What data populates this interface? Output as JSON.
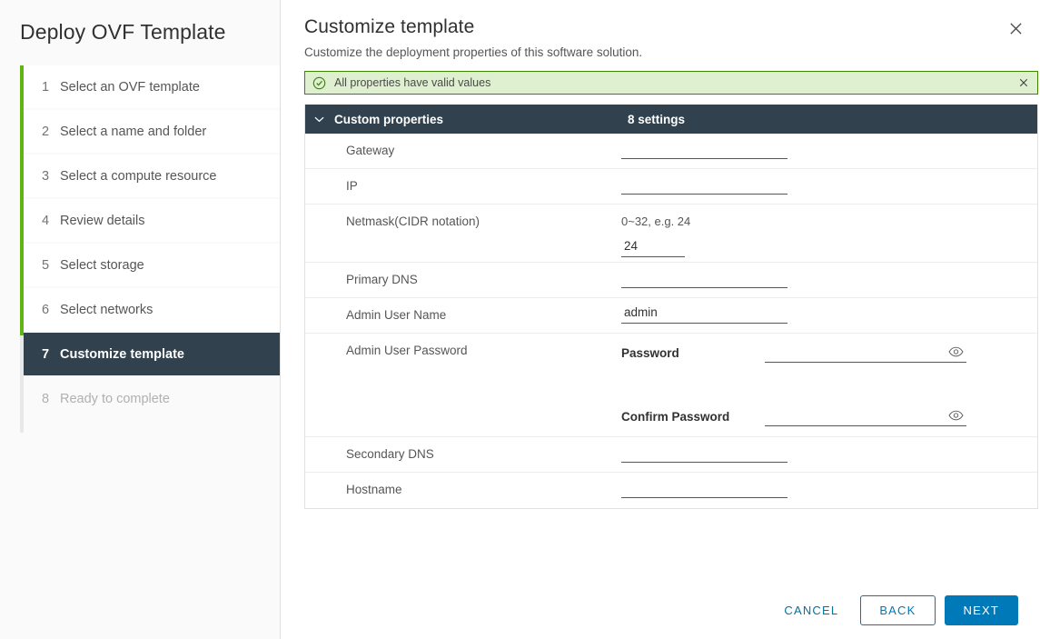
{
  "sidebar": {
    "title": "Deploy OVF Template",
    "steps": [
      {
        "num": "1",
        "label": "Select an OVF template",
        "state": "done"
      },
      {
        "num": "2",
        "label": "Select a name and folder",
        "state": "done"
      },
      {
        "num": "3",
        "label": "Select a compute resource",
        "state": "done"
      },
      {
        "num": "4",
        "label": "Review details",
        "state": "done"
      },
      {
        "num": "5",
        "label": "Select storage",
        "state": "done"
      },
      {
        "num": "6",
        "label": "Select networks",
        "state": "done"
      },
      {
        "num": "7",
        "label": "Customize template",
        "state": "active"
      },
      {
        "num": "8",
        "label": "Ready to complete",
        "state": "disabled"
      }
    ]
  },
  "header": {
    "title": "Customize template",
    "subtitle": "Customize the deployment properties of this software solution.",
    "close_icon": "close-icon"
  },
  "banner": {
    "icon": "check-circle-icon",
    "message": "All properties have valid values",
    "close_icon": "close-icon",
    "bg_color": "#dff0d0",
    "border_color": "#3c8500"
  },
  "properties": {
    "section_title": "Custom properties",
    "settings_count": "8 settings",
    "chevron_icon": "chevron-down-icon",
    "rows": [
      {
        "label": "Gateway",
        "value": "",
        "placeholder": ""
      },
      {
        "label": "IP",
        "value": "",
        "placeholder": ""
      },
      {
        "label": "Netmask(CIDR notation)",
        "hint": "0~32, e.g. 24",
        "value": "24",
        "placeholder": ""
      },
      {
        "label": "Primary DNS",
        "value": "",
        "placeholder": ""
      },
      {
        "label": "Admin User Name",
        "value": "admin",
        "placeholder": ""
      },
      {
        "label": "Admin User Password",
        "password_fields": [
          {
            "sublabel": "Password",
            "value": "",
            "reveal_icon": "eye-icon"
          },
          {
            "sublabel": "Confirm Password",
            "value": "",
            "reveal_icon": "eye-icon"
          }
        ]
      },
      {
        "label": "Secondary DNS",
        "value": "",
        "placeholder": ""
      },
      {
        "label": "Hostname",
        "value": "",
        "placeholder": ""
      }
    ]
  },
  "footer": {
    "cancel_label": "CANCEL",
    "back_label": "BACK",
    "next_label": "NEXT",
    "accent_color": "#0079b8"
  }
}
